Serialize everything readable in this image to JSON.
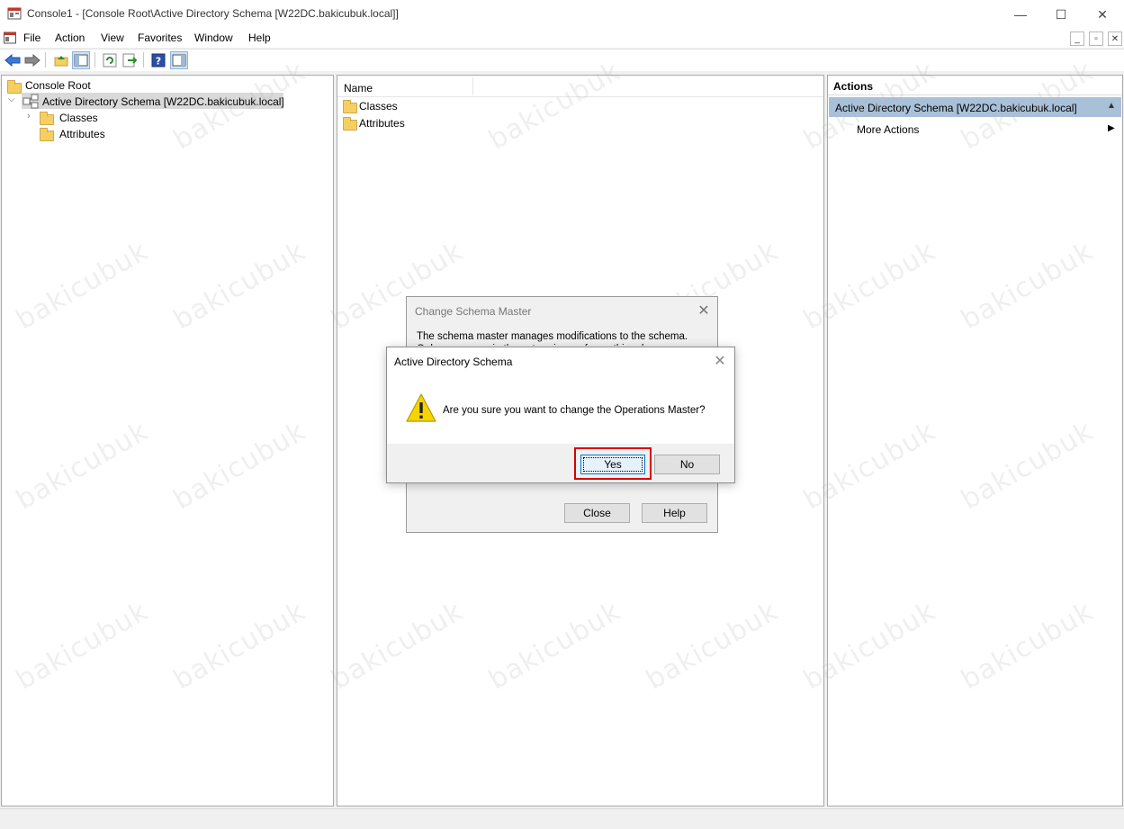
{
  "window": {
    "title": "Console1 - [Console Root\\Active Directory Schema [W22DC.bakicubuk.local]]",
    "minimize_glyph": "—",
    "maximize_glyph": "☐",
    "close_glyph": "✕"
  },
  "menu": {
    "items": [
      "File",
      "Action",
      "View",
      "Favorites",
      "Window",
      "Help"
    ]
  },
  "toolbar": {
    "icons": [
      "back-arrow-icon",
      "forward-arrow-icon",
      "up-folder-icon",
      "show-hide-tree-icon",
      "refresh-icon",
      "export-list-icon",
      "help-icon",
      "show-hide-action-pane-icon"
    ]
  },
  "tree": {
    "root": "Console Root",
    "schema_node": "Active Directory Schema [W22DC.bakicubuk.local]",
    "children": [
      "Classes",
      "Attributes"
    ]
  },
  "list": {
    "column_name": "Name",
    "items": [
      "Classes",
      "Attributes"
    ]
  },
  "actions": {
    "header": "Actions",
    "section": "Active Directory Schema [W22DC.bakicubuk.local]",
    "more_actions": "More Actions"
  },
  "back_dialog": {
    "title": "Change Schema Master",
    "description": "The schema master manages modifications to the schema. Only one server in the enterprise performs this role.",
    "close_label": "Close",
    "help_label": "Help"
  },
  "confirm_dialog": {
    "title": "Active Directory Schema",
    "message": "Are you sure you want to change the Operations Master?",
    "yes_label": "Yes",
    "no_label": "No"
  },
  "watermark": "bakicubuk",
  "colors": {
    "selection": "#a9c0d9",
    "highlight": "#d90000",
    "warning": "#f5d400"
  }
}
